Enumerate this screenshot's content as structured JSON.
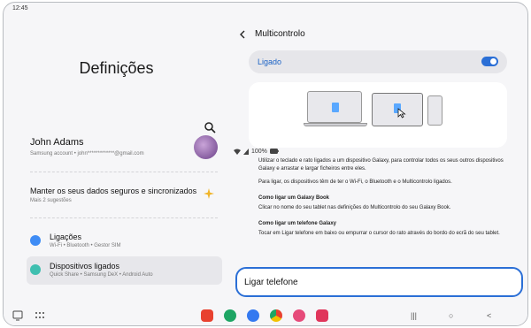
{
  "status": {
    "time": "12:45",
    "battery": "100%"
  },
  "left": {
    "title": "Definições",
    "account": {
      "name": "John Adams",
      "email": "Samsung account  •  john*************@gmail.com"
    },
    "suggestion": {
      "title": "Manter os seus dados seguros e sincronizados",
      "subtitle": "Mais 2 sugestões"
    },
    "items": [
      {
        "title": "Ligações",
        "subtitle": "Wi-Fi  •  Bluetooth  •  Gestor SIM",
        "color": "#3f8cf5"
      },
      {
        "title": "Dispositivos ligados",
        "subtitle": "Quick Share  •  Samsung DeX  •  Android Auto",
        "color": "#3fbfb0"
      }
    ]
  },
  "right": {
    "header": "Multicontrolo",
    "toggle_label": "Ligado",
    "paragraphs": [
      "Utilizar o teclado e rato ligados a um dispositivo Galaxy, para controlar todos os seus outros dispositivos Galaxy e arrastar e largar ficheiros entre eles.",
      "Para ligar, os dispositivos têm de ter o Wi-Fi, o Bluetooth e o Multicontrolo ligados."
    ],
    "galaxy_book_heading": "Como ligar um Galaxy Book",
    "galaxy_book_text": "Clicar no nome do seu tablet nas definições do Multicontrolo do seu Galaxy Book.",
    "phone_heading": "Como ligar um telefone Galaxy",
    "phone_text": "Tocar em Ligar telefone em baixo ou empurrar o cursor do rato através do bordo do ecrã do seu tablet.",
    "call_button": "Ligar telefone"
  },
  "navbar": {
    "apps": [
      {
        "name": "app-red",
        "color": "#e8412f"
      },
      {
        "name": "app-green",
        "color": "#1ea564"
      },
      {
        "name": "app-messages",
        "color": "#3479f0"
      },
      {
        "name": "app-chrome",
        "color": "#e0a326"
      },
      {
        "name": "app-flower",
        "color": "#e64b7a"
      },
      {
        "name": "app-camera",
        "color": "#e0355b"
      }
    ],
    "recent": "|||",
    "home": "○",
    "back": "<"
  }
}
